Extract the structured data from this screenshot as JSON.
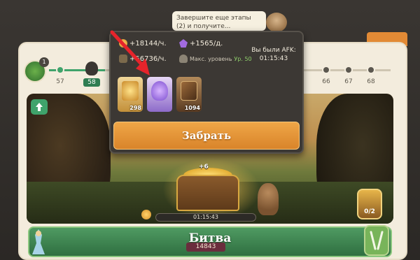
{
  "hint": {
    "text": "Завершите еще этапы (2) и получите..."
  },
  "stages": {
    "badge_count": "1",
    "current_index_label": "58",
    "numbers": [
      "57",
      "58",
      "66",
      "67",
      "68"
    ]
  },
  "afk_popup": {
    "gold_rate": "+18144/ч.",
    "crystal_rate": "+1565/д.",
    "xp_rate": "+56736/ч.",
    "max_level_label": "Макс. уровень",
    "max_level_value": "Ур. 50",
    "afk_title": "Вы были AFK:",
    "afk_time": "01:15:43",
    "rewards": [
      {
        "name": "gold",
        "amount": "298"
      },
      {
        "name": "potion",
        "amount": ""
      },
      {
        "name": "book",
        "amount": "1094"
      }
    ],
    "claim_label": "Забрать"
  },
  "scene": {
    "chest_bonus": "+6",
    "timer": "01:15:43",
    "hero_count": "0/2"
  },
  "battle": {
    "label": "Битва",
    "power": "14843"
  },
  "colors": {
    "accent_green": "#3fa36b",
    "claim_orange": "#e0902f",
    "popup_bg": "#3c3834"
  }
}
